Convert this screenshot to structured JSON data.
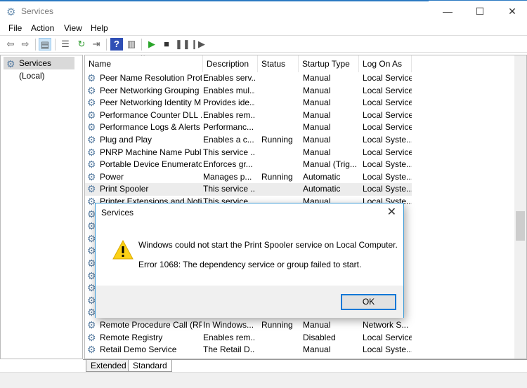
{
  "window": {
    "title": "Services",
    "min": "—",
    "max": "☐",
    "close": "✕"
  },
  "menu": [
    "File",
    "Action",
    "View",
    "Help"
  ],
  "toolbar": [
    "back",
    "forward",
    "show-hide-console-tree",
    "properties",
    "refresh",
    "export-list",
    "help",
    "show-action-pane",
    "start",
    "stop",
    "pause",
    "resume"
  ],
  "tree": {
    "root": "Services (Local)"
  },
  "columns": [
    "Name",
    "Description",
    "Status",
    "Startup Type",
    "Log On As"
  ],
  "rows": [
    [
      "Peer Name Resolution Prot...",
      "Enables serv...",
      "",
      "Manual",
      "Local Service"
    ],
    [
      "Peer Networking Grouping",
      "Enables mul...",
      "",
      "Manual",
      "Local Service"
    ],
    [
      "Peer Networking Identity M...",
      "Provides ide...",
      "",
      "Manual",
      "Local Service"
    ],
    [
      "Performance Counter DLL ...",
      "Enables rem...",
      "",
      "Manual",
      "Local Service"
    ],
    [
      "Performance Logs & Alerts",
      "Performanc...",
      "",
      "Manual",
      "Local Service"
    ],
    [
      "Plug and Play",
      "Enables a c...",
      "Running",
      "Manual",
      "Local Syste..."
    ],
    [
      "PNRP Machine Name Publi...",
      "This service ...",
      "",
      "Manual",
      "Local Service"
    ],
    [
      "Portable Device Enumerator...",
      "Enforces gr...",
      "",
      "Manual (Trig...",
      "Local Syste..."
    ],
    [
      "Power",
      "Manages p...",
      "Running",
      "Automatic",
      "Local Syste..."
    ],
    [
      "Print Spooler",
      "This service ...",
      "",
      "Automatic",
      "Local Syste..."
    ],
    [
      "Printer Extensions and Notif...",
      "This service ...",
      "",
      "Manual",
      "Local Syste..."
    ]
  ],
  "rows_bottom": [
    [
      "Remote Procedure Call (RP...",
      "In Windows...",
      "Running",
      "Manual",
      "Network S..."
    ],
    [
      "Remote Registry",
      "Enables rem...",
      "",
      "Disabled",
      "Local Service"
    ],
    [
      "Retail Demo Service",
      "The Retail D...",
      "",
      "Manual",
      "Local Syste..."
    ]
  ],
  "selected_row": "Print Spooler",
  "tabs": [
    "Extended",
    "Standard"
  ],
  "active_tab": "Standard",
  "dialog": {
    "title": "Services",
    "close": "✕",
    "message": "Windows could not start the Print Spooler service on Local Computer.",
    "error": "Error 1068: The dependency service or group failed to start.",
    "ok": "OK",
    "icon": "warning-icon"
  }
}
